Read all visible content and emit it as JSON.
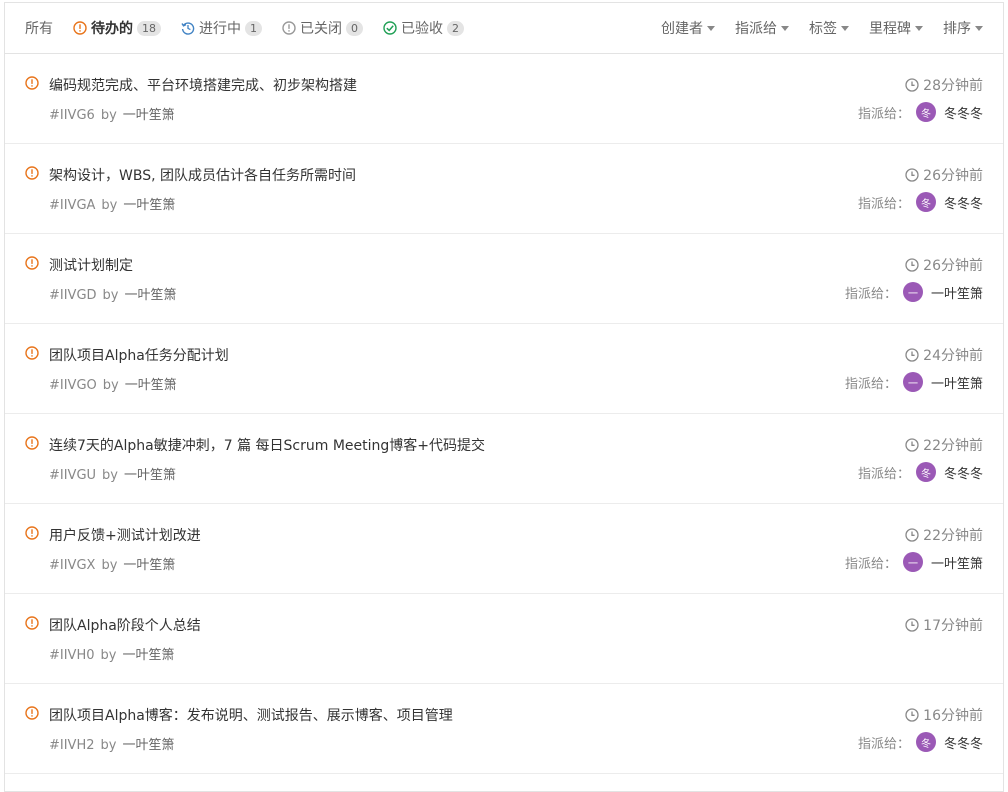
{
  "tabs": [
    {
      "label": "所有",
      "count": "",
      "icon": "none",
      "active": false
    },
    {
      "label": "待办的",
      "count": "18",
      "icon": "alert-icon",
      "active": true
    },
    {
      "label": "进行中",
      "count": "1",
      "icon": "progress-icon",
      "active": false
    },
    {
      "label": "已关闭",
      "count": "0",
      "icon": "closed-icon",
      "active": false
    },
    {
      "label": "已验收",
      "count": "2",
      "icon": "check-icon",
      "active": false
    }
  ],
  "filters": [
    "创建者",
    "指派给",
    "标签",
    "里程碑",
    "排序"
  ],
  "assign_label": "指派给：",
  "by_label": "by",
  "colors": {
    "open": "#e8741b",
    "accent": "#4183c4",
    "check": "#21a056",
    "avatar": "#9b59b6"
  },
  "issues": [
    {
      "title": "编码规范完成、平台环境搭建完成、初步架构搭建",
      "id": "#IIVG6",
      "author": "一叶笙箫",
      "time": "28分钟前",
      "assignee": "冬冬冬",
      "avatar": "冬"
    },
    {
      "title": " 架构设计，WBS, 团队成员估计各自任务所需时间",
      "id": "#IIVGA",
      "author": "一叶笙箫",
      "time": "26分钟前",
      "assignee": "冬冬冬",
      "avatar": "冬"
    },
    {
      "title": "测试计划制定",
      "id": "#IIVGD",
      "author": "一叶笙箫",
      "time": "26分钟前",
      "assignee": "一叶笙箫",
      "avatar": "一"
    },
    {
      "title": "团队项目Alpha任务分配计划",
      "id": "#IIVGO",
      "author": "一叶笙箫",
      "time": "24分钟前",
      "assignee": "一叶笙箫",
      "avatar": "一"
    },
    {
      "title": "连续7天的Alpha敏捷冲刺，7 篇 每日Scrum Meeting博客+代码提交",
      "id": "#IIVGU",
      "author": "一叶笙箫",
      "time": "22分钟前",
      "assignee": "冬冬冬",
      "avatar": "冬"
    },
    {
      "title": "用户反馈+测试计划改进",
      "id": "#IIVGX",
      "author": "一叶笙箫",
      "time": "22分钟前",
      "assignee": "一叶笙箫",
      "avatar": "一"
    },
    {
      "title": "团队Alpha阶段个人总结",
      "id": "#IIVH0",
      "author": "一叶笙箫",
      "time": "17分钟前",
      "assignee": "",
      "avatar": ""
    },
    {
      "title": "团队项目Alpha博客：发布说明、测试报告、展示博客、项目管理",
      "id": "#IIVH2",
      "author": "一叶笙箫",
      "time": "16分钟前",
      "assignee": "冬冬冬",
      "avatar": "冬"
    }
  ]
}
